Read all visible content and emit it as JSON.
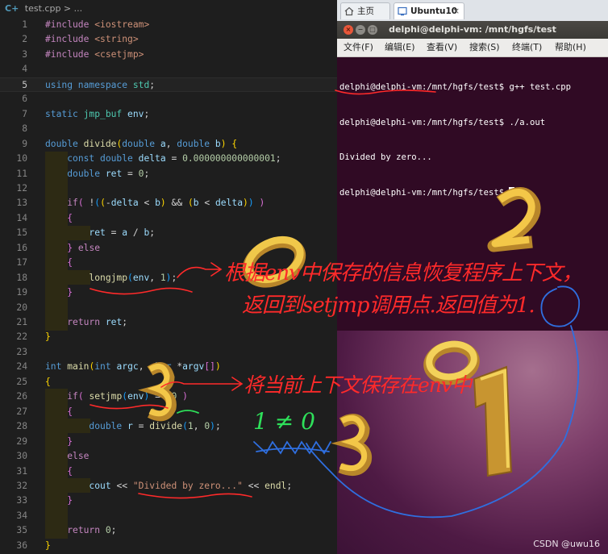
{
  "editor": {
    "breadcrumb_icon": "C+",
    "breadcrumb": "test.cpp > ...",
    "lines": [
      {
        "n": "1",
        "html": "<span class='inc'>#include</span> <span class='hd'>&lt;iostream&gt;</span>"
      },
      {
        "n": "2",
        "html": "<span class='inc'>#include</span> <span class='hd'>&lt;string&gt;</span>"
      },
      {
        "n": "3",
        "html": "<span class='inc'>#include</span> <span class='hd'>&lt;csetjmp&gt;</span>"
      },
      {
        "n": "4",
        "html": ""
      },
      {
        "n": "5",
        "html": "<span class='kw'>using namespace</span> <span class='ty'>std</span>;",
        "current": true
      },
      {
        "n": "6",
        "html": ""
      },
      {
        "n": "7",
        "html": "<span class='kw'>static</span> <span class='ty'>jmp_buf</span> <span class='va'>env</span>;"
      },
      {
        "n": "8",
        "html": ""
      },
      {
        "n": "9",
        "html": "<span class='kw'>double</span> <span class='fn'>divide</span><span class='br'>(</span><span class='kw'>double</span> <span class='va'>a</span>, <span class='kw'>double</span> <span class='va'>b</span><span class='br'>)</span> <span class='br'>{</span>"
      },
      {
        "n": "10",
        "html": "    <span class='kw'>const double</span> <span class='va'>delta</span> = <span class='nu'>0.000000000000001</span>;"
      },
      {
        "n": "11",
        "html": "    <span class='kw'>double</span> <span class='va'>ret</span> = <span class='nu'>0</span>;"
      },
      {
        "n": "12",
        "html": ""
      },
      {
        "n": "13",
        "html": "    <span class='inc'>if</span><span class='br2'>(</span> !<span class='br3'>(</span><span class='br'>(</span>-<span class='va'>delta</span> &lt; <span class='va'>b</span><span class='br'>)</span> &amp;&amp; <span class='br'>(</span><span class='va'>b</span> &lt; <span class='va'>delta</span><span class='br'>)</span><span class='br3'>)</span> <span class='br2'>)</span>"
      },
      {
        "n": "14",
        "html": "    <span class='br2'>{</span>"
      },
      {
        "n": "15",
        "html": "        <span class='va'>ret</span> = <span class='va'>a</span> / <span class='va'>b</span>;"
      },
      {
        "n": "16",
        "html": "    <span class='br2'>}</span> <span class='inc'>else</span>"
      },
      {
        "n": "17",
        "html": "    <span class='br2'>{</span>"
      },
      {
        "n": "18",
        "html": "        <span class='fn'>longjmp</span><span class='br3'>(</span><span class='va'>env</span>, <span class='nu'>1</span><span class='br3'>)</span>;"
      },
      {
        "n": "19",
        "html": "    <span class='br2'>}</span>"
      },
      {
        "n": "20",
        "html": ""
      },
      {
        "n": "21",
        "html": "    <span class='inc'>return</span> <span class='va'>ret</span>;"
      },
      {
        "n": "22",
        "html": "<span class='br'>}</span>"
      },
      {
        "n": "23",
        "html": ""
      },
      {
        "n": "24",
        "html": "<span class='kw'>int</span> <span class='fn'>main</span><span class='br'>(</span><span class='kw'>int</span> <span class='va'>argc</span>, <span class='kw'>char</span> *<span class='va'>argv</span><span class='br2'>[]</span><span class='br'>)</span>"
      },
      {
        "n": "25",
        "html": "<span class='br'>{</span>"
      },
      {
        "n": "26",
        "html": "    <span class='inc'>if</span><span class='br2'>(</span> <span class='fn'>setjmp</span><span class='br3'>(</span><span class='va'>env</span><span class='br3'>)</span> == <span class='nu'>0</span> <span class='br2'>)</span>"
      },
      {
        "n": "27",
        "html": "    <span class='br2'>{</span>"
      },
      {
        "n": "28",
        "html": "        <span class='kw'>double</span> <span class='va'>r</span> = <span class='fn'>divide</span><span class='br3'>(</span><span class='nu'>1</span>, <span class='nu'>0</span><span class='br3'>)</span>;"
      },
      {
        "n": "29",
        "html": "    <span class='br2'>}</span>"
      },
      {
        "n": "30",
        "html": "    <span class='inc'>else</span>"
      },
      {
        "n": "31",
        "html": "    <span class='br2'>{</span>"
      },
      {
        "n": "32",
        "html": "        <span class='va'>cout</span> &lt;&lt; <span class='st'>\"Divided by zero...\"</span> &lt;&lt; <span class='fn'>endl</span>;"
      },
      {
        "n": "33",
        "html": "    <span class='br2'>}</span>"
      },
      {
        "n": "34",
        "html": ""
      },
      {
        "n": "35",
        "html": "    <span class='inc'>return</span> <span class='nu'>0</span>;"
      },
      {
        "n": "36",
        "html": "<span class='br'>}</span>"
      }
    ]
  },
  "browser": {
    "tab_home": "主页",
    "tab_vm": "Ubuntu10",
    "close": "×"
  },
  "terminal": {
    "title": "delphi@delphi-vm: /mnt/hgfs/test",
    "menu": [
      "文件(F)",
      "编辑(E)",
      "查看(V)",
      "搜索(S)",
      "终端(T)",
      "帮助(H)"
    ],
    "lines": [
      "delphi@delphi-vm:/mnt/hgfs/test$ g++ test.cpp",
      "delphi@delphi-vm:/mnt/hgfs/test$ ./a.out",
      "Divided by zero...",
      "delphi@delphi-vm:/mnt/hgfs/test$ "
    ]
  },
  "annotations": {
    "note1": "根据env中保存的信息恢复程序上下文，",
    "note2": "返回到setjmp调用点.返回值为1.",
    "note3": "将当前上下文保存在env中",
    "note4": "1 ≠ 0"
  },
  "watermark": "CSDN @uwu16",
  "colors": {
    "ink_red": "#ff2a2a",
    "ink_blue": "#2f6fe0",
    "ink_green": "#2ee05a",
    "gold": "#e0b43a"
  }
}
